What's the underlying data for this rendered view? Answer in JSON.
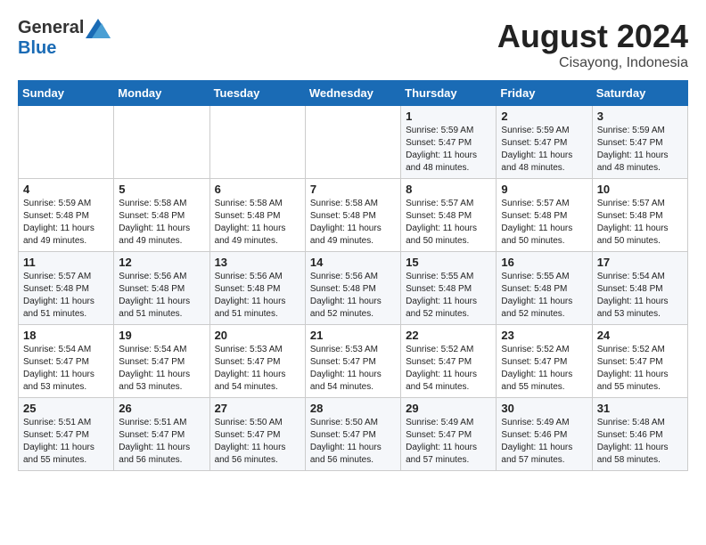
{
  "header": {
    "logo_general": "General",
    "logo_blue": "Blue",
    "month_year": "August 2024",
    "location": "Cisayong, Indonesia"
  },
  "weekdays": [
    "Sunday",
    "Monday",
    "Tuesday",
    "Wednesday",
    "Thursday",
    "Friday",
    "Saturday"
  ],
  "weeks": [
    [
      {
        "day": "",
        "info": ""
      },
      {
        "day": "",
        "info": ""
      },
      {
        "day": "",
        "info": ""
      },
      {
        "day": "",
        "info": ""
      },
      {
        "day": "1",
        "info": "Sunrise: 5:59 AM\nSunset: 5:47 PM\nDaylight: 11 hours\nand 48 minutes."
      },
      {
        "day": "2",
        "info": "Sunrise: 5:59 AM\nSunset: 5:47 PM\nDaylight: 11 hours\nand 48 minutes."
      },
      {
        "day": "3",
        "info": "Sunrise: 5:59 AM\nSunset: 5:47 PM\nDaylight: 11 hours\nand 48 minutes."
      }
    ],
    [
      {
        "day": "4",
        "info": "Sunrise: 5:59 AM\nSunset: 5:48 PM\nDaylight: 11 hours\nand 49 minutes."
      },
      {
        "day": "5",
        "info": "Sunrise: 5:58 AM\nSunset: 5:48 PM\nDaylight: 11 hours\nand 49 minutes."
      },
      {
        "day": "6",
        "info": "Sunrise: 5:58 AM\nSunset: 5:48 PM\nDaylight: 11 hours\nand 49 minutes."
      },
      {
        "day": "7",
        "info": "Sunrise: 5:58 AM\nSunset: 5:48 PM\nDaylight: 11 hours\nand 49 minutes."
      },
      {
        "day": "8",
        "info": "Sunrise: 5:57 AM\nSunset: 5:48 PM\nDaylight: 11 hours\nand 50 minutes."
      },
      {
        "day": "9",
        "info": "Sunrise: 5:57 AM\nSunset: 5:48 PM\nDaylight: 11 hours\nand 50 minutes."
      },
      {
        "day": "10",
        "info": "Sunrise: 5:57 AM\nSunset: 5:48 PM\nDaylight: 11 hours\nand 50 minutes."
      }
    ],
    [
      {
        "day": "11",
        "info": "Sunrise: 5:57 AM\nSunset: 5:48 PM\nDaylight: 11 hours\nand 51 minutes."
      },
      {
        "day": "12",
        "info": "Sunrise: 5:56 AM\nSunset: 5:48 PM\nDaylight: 11 hours\nand 51 minutes."
      },
      {
        "day": "13",
        "info": "Sunrise: 5:56 AM\nSunset: 5:48 PM\nDaylight: 11 hours\nand 51 minutes."
      },
      {
        "day": "14",
        "info": "Sunrise: 5:56 AM\nSunset: 5:48 PM\nDaylight: 11 hours\nand 52 minutes."
      },
      {
        "day": "15",
        "info": "Sunrise: 5:55 AM\nSunset: 5:48 PM\nDaylight: 11 hours\nand 52 minutes."
      },
      {
        "day": "16",
        "info": "Sunrise: 5:55 AM\nSunset: 5:48 PM\nDaylight: 11 hours\nand 52 minutes."
      },
      {
        "day": "17",
        "info": "Sunrise: 5:54 AM\nSunset: 5:48 PM\nDaylight: 11 hours\nand 53 minutes."
      }
    ],
    [
      {
        "day": "18",
        "info": "Sunrise: 5:54 AM\nSunset: 5:47 PM\nDaylight: 11 hours\nand 53 minutes."
      },
      {
        "day": "19",
        "info": "Sunrise: 5:54 AM\nSunset: 5:47 PM\nDaylight: 11 hours\nand 53 minutes."
      },
      {
        "day": "20",
        "info": "Sunrise: 5:53 AM\nSunset: 5:47 PM\nDaylight: 11 hours\nand 54 minutes."
      },
      {
        "day": "21",
        "info": "Sunrise: 5:53 AM\nSunset: 5:47 PM\nDaylight: 11 hours\nand 54 minutes."
      },
      {
        "day": "22",
        "info": "Sunrise: 5:52 AM\nSunset: 5:47 PM\nDaylight: 11 hours\nand 54 minutes."
      },
      {
        "day": "23",
        "info": "Sunrise: 5:52 AM\nSunset: 5:47 PM\nDaylight: 11 hours\nand 55 minutes."
      },
      {
        "day": "24",
        "info": "Sunrise: 5:52 AM\nSunset: 5:47 PM\nDaylight: 11 hours\nand 55 minutes."
      }
    ],
    [
      {
        "day": "25",
        "info": "Sunrise: 5:51 AM\nSunset: 5:47 PM\nDaylight: 11 hours\nand 55 minutes."
      },
      {
        "day": "26",
        "info": "Sunrise: 5:51 AM\nSunset: 5:47 PM\nDaylight: 11 hours\nand 56 minutes."
      },
      {
        "day": "27",
        "info": "Sunrise: 5:50 AM\nSunset: 5:47 PM\nDaylight: 11 hours\nand 56 minutes."
      },
      {
        "day": "28",
        "info": "Sunrise: 5:50 AM\nSunset: 5:47 PM\nDaylight: 11 hours\nand 56 minutes."
      },
      {
        "day": "29",
        "info": "Sunrise: 5:49 AM\nSunset: 5:47 PM\nDaylight: 11 hours\nand 57 minutes."
      },
      {
        "day": "30",
        "info": "Sunrise: 5:49 AM\nSunset: 5:46 PM\nDaylight: 11 hours\nand 57 minutes."
      },
      {
        "day": "31",
        "info": "Sunrise: 5:48 AM\nSunset: 5:46 PM\nDaylight: 11 hours\nand 58 minutes."
      }
    ]
  ]
}
